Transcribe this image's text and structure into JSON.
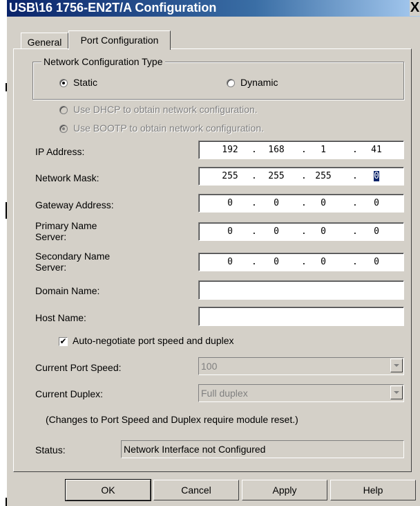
{
  "window": {
    "title": "USB\\16 1756-EN2T/A Configuration",
    "close_glyph": "X"
  },
  "tabs": [
    {
      "label": "General"
    },
    {
      "label": "Port Configuration"
    }
  ],
  "network_type": {
    "group_label": "Network Configuration Type",
    "static_label": "Static",
    "dynamic_label": "Dynamic",
    "selected": "Static"
  },
  "dynamic_options": {
    "dhcp_label": "Use DHCP to obtain network configuration.",
    "bootp_label": "Use BOOTP to obtain network configuration."
  },
  "fields": {
    "ip": {
      "label": "IP Address:",
      "octets": [
        "192",
        "168",
        "1",
        "41"
      ]
    },
    "mask": {
      "label": "Network Mask:",
      "octets": [
        "255",
        "255",
        "255",
        "0"
      ]
    },
    "gateway": {
      "label": "Gateway Address:",
      "octets": [
        "0",
        "0",
        "0",
        "0"
      ]
    },
    "primary_dns": {
      "label_line1": "Primary Name",
      "label_line2": "Server:",
      "octets": [
        "0",
        "0",
        "0",
        "0"
      ]
    },
    "secondary_dns": {
      "label_line1": "Secondary Name",
      "label_line2": "Server:",
      "octets": [
        "0",
        "0",
        "0",
        "0"
      ]
    },
    "domain": {
      "label": "Domain Name:",
      "value": ""
    },
    "host": {
      "label": "Host Name:",
      "value": ""
    }
  },
  "autoneg": {
    "label": "Auto-negotiate port speed and duplex",
    "checked": true
  },
  "port_speed": {
    "label": "Current Port Speed:",
    "value": "100"
  },
  "duplex": {
    "label": "Current Duplex:",
    "value": "Full duplex"
  },
  "note": "(Changes to Port Speed and Duplex require module reset.)",
  "status": {
    "label": "Status:",
    "value": "Network Interface not Configured"
  },
  "buttons": {
    "ok": "OK",
    "cancel": "Cancel",
    "apply": "Apply",
    "help": "Help"
  },
  "colors": {
    "dialog_bg": "#d4d0c8",
    "title_start": "#0a246a",
    "title_end": "#a6caf0",
    "disabled_text": "#808080"
  }
}
